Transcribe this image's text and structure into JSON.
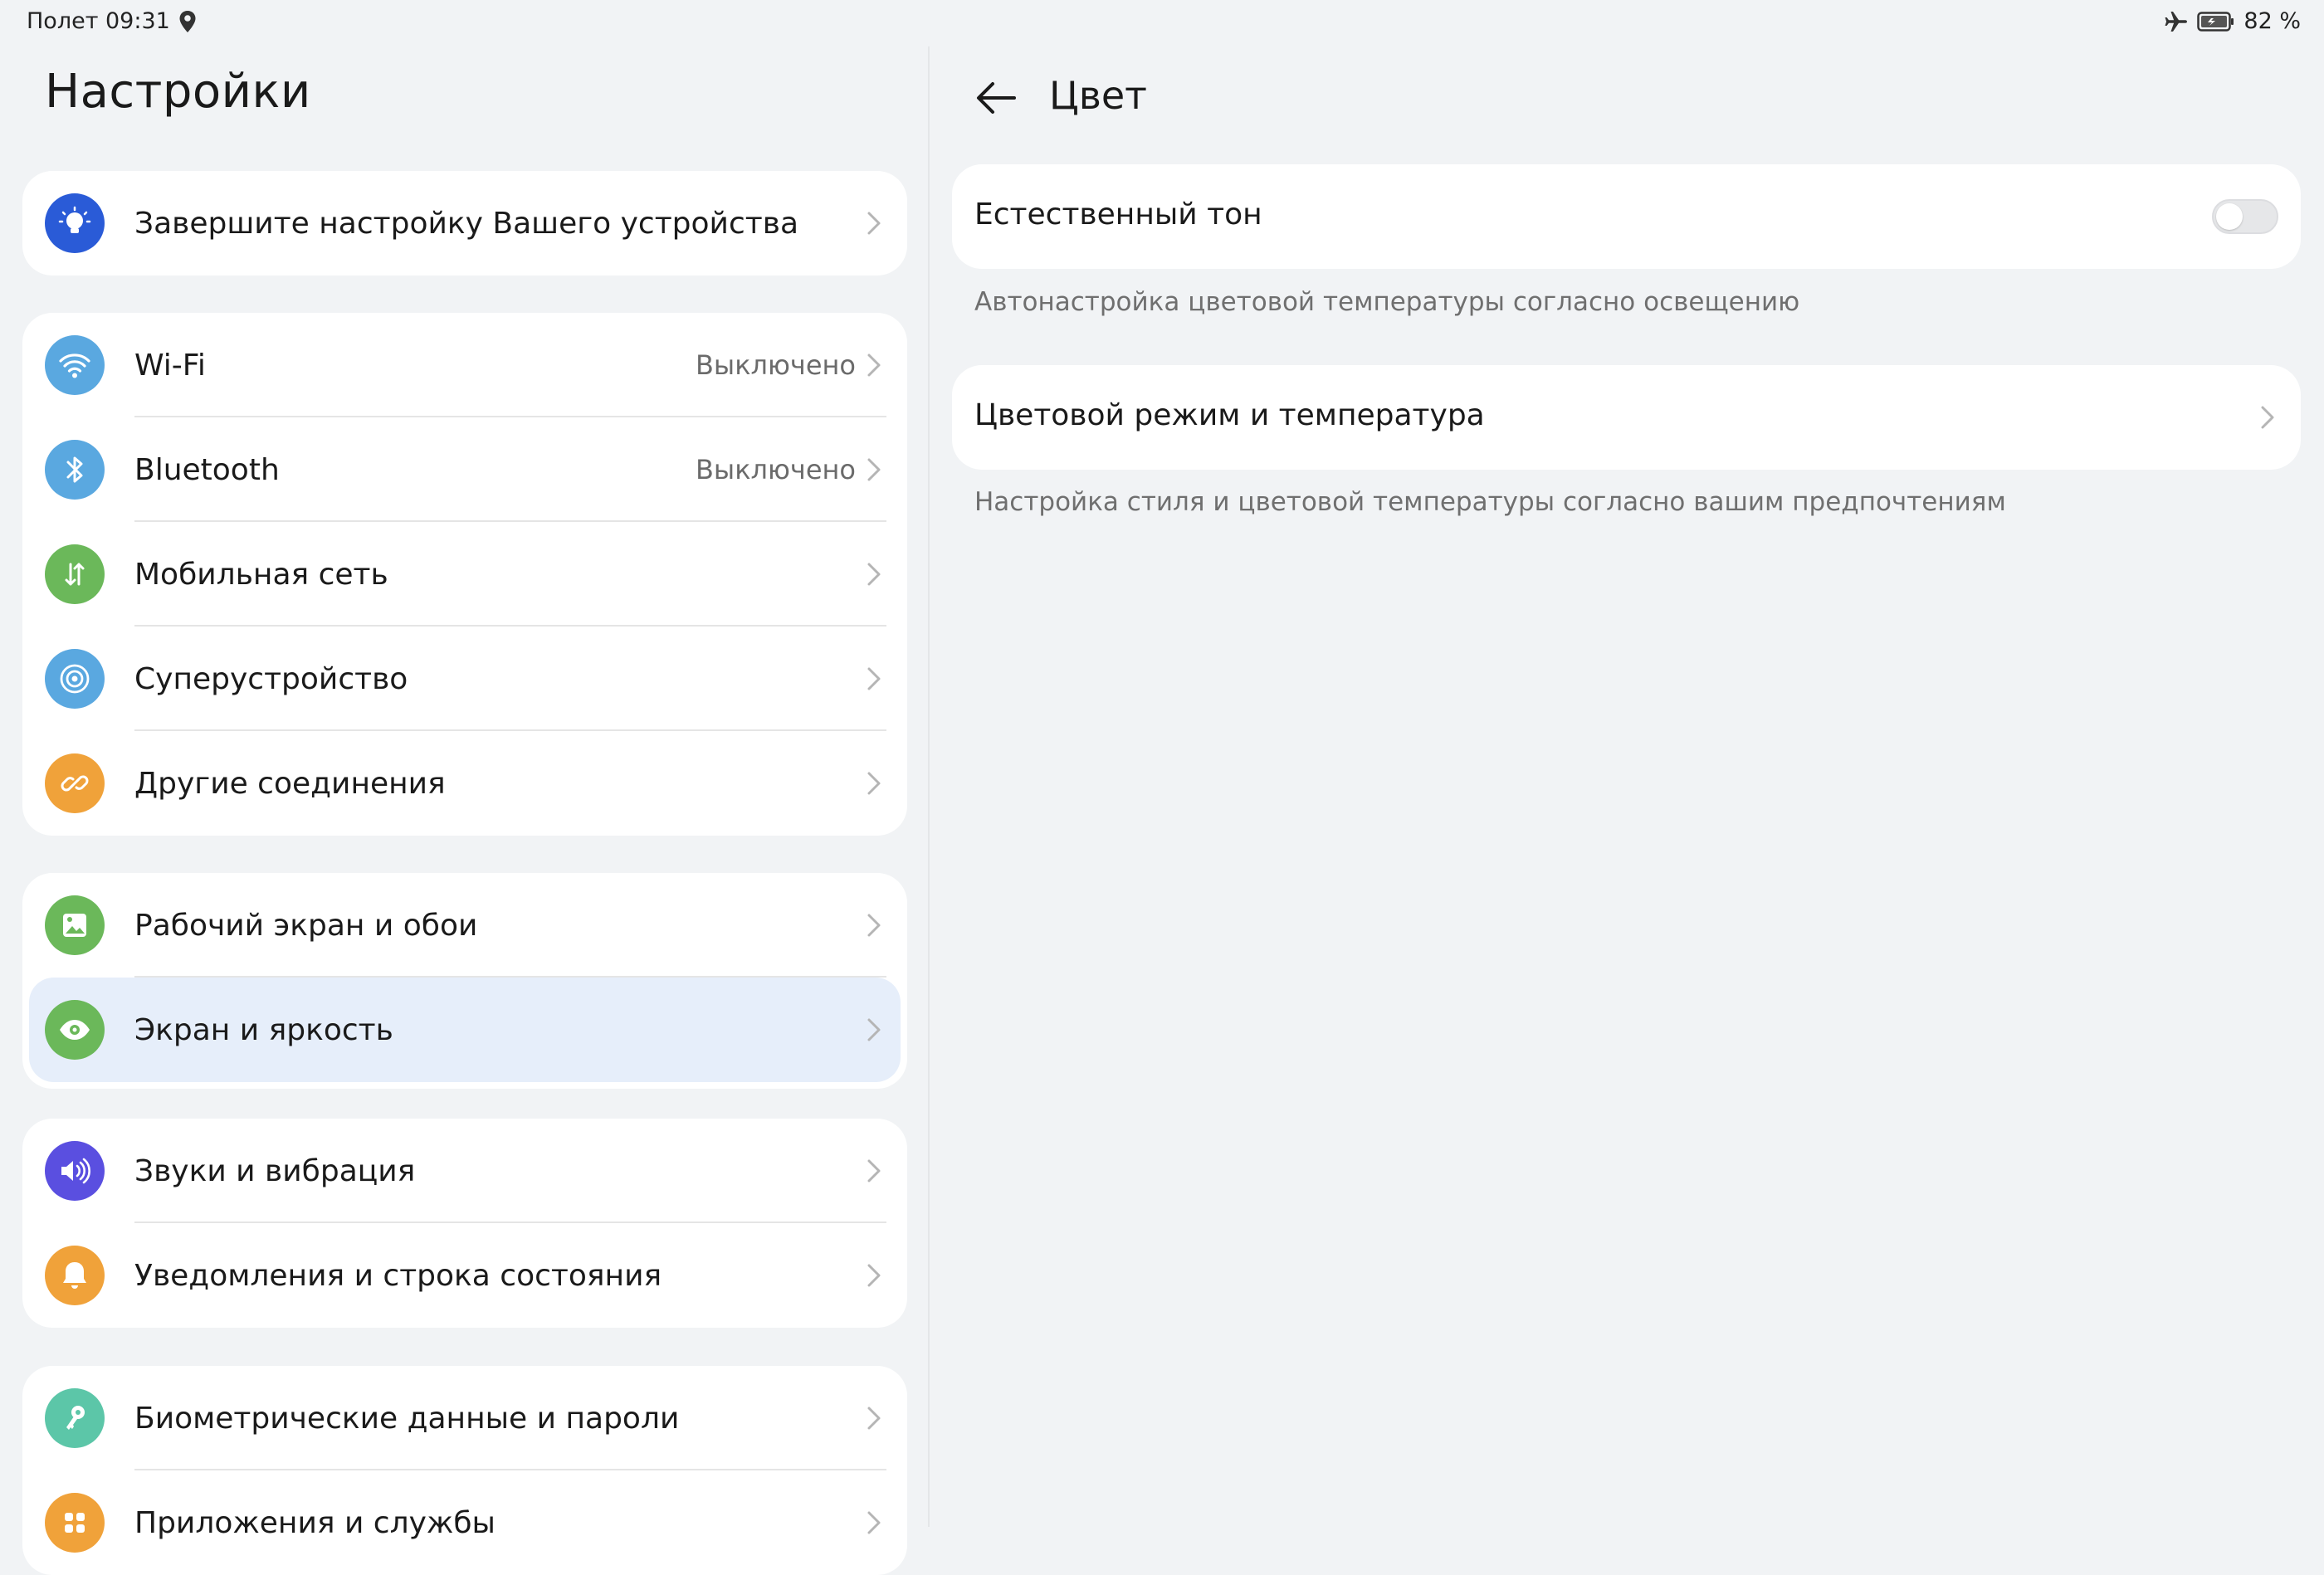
{
  "status_bar": {
    "left_text": "Полет 09:31",
    "battery": "82 %",
    "icons": [
      "location-icon",
      "airplane-icon",
      "battery-icon"
    ]
  },
  "settings": {
    "title": "Настройки",
    "groups": [
      {
        "items": [
          {
            "label": "Завершите настройку Вашего устройства",
            "icon": "lightbulb-icon",
            "color": "#2a5bd7"
          }
        ]
      },
      {
        "items": [
          {
            "label": "Wi-Fi",
            "value": "Выключено",
            "icon": "wifi-icon",
            "color": "#5aa8e0"
          },
          {
            "label": "Bluetooth",
            "value": "Выключено",
            "icon": "bluetooth-icon",
            "color": "#5aa8e0"
          },
          {
            "label": "Мобильная сеть",
            "icon": "mobile-data-icon",
            "color": "#6bb85a"
          },
          {
            "label": "Суперустройство",
            "icon": "superdevice-icon",
            "color": "#5aa8e0"
          },
          {
            "label": "Другие соединения",
            "icon": "link-icon",
            "color": "#f0a23a"
          }
        ]
      },
      {
        "items": [
          {
            "label": "Рабочий экран и обои",
            "icon": "wallpaper-icon",
            "color": "#6bb85a"
          },
          {
            "label": "Экран и яркость",
            "icon": "eye-icon",
            "color": "#6bb85a",
            "selected": true
          }
        ]
      },
      {
        "items": [
          {
            "label": "Звуки и вибрация",
            "icon": "sound-icon",
            "color": "#5a4fe0"
          },
          {
            "label": "Уведомления и строка состояния",
            "icon": "bell-icon",
            "color": "#f0a23a"
          }
        ]
      },
      {
        "items": [
          {
            "label": "Биометрические данные и пароли",
            "icon": "key-icon",
            "color": "#5cc6a8"
          },
          {
            "label": "Приложения и службы",
            "icon": "apps-icon",
            "color": "#f0a23a"
          }
        ]
      }
    ]
  },
  "detail": {
    "title": "Цвет",
    "natural_tone": {
      "label": "Естественный тон",
      "enabled": false,
      "hint": "Автонастройка цветовой температуры согласно освещению"
    },
    "color_mode": {
      "label": "Цветовой режим и температура",
      "hint": "Настройка стиля и цветовой температуры согласно вашим предпочтениям"
    }
  },
  "colors": {
    "background": "#f1f3f5",
    "card": "#ffffff",
    "selected_row": "#e6eefa",
    "secondary_text": "#6b6b6b"
  }
}
